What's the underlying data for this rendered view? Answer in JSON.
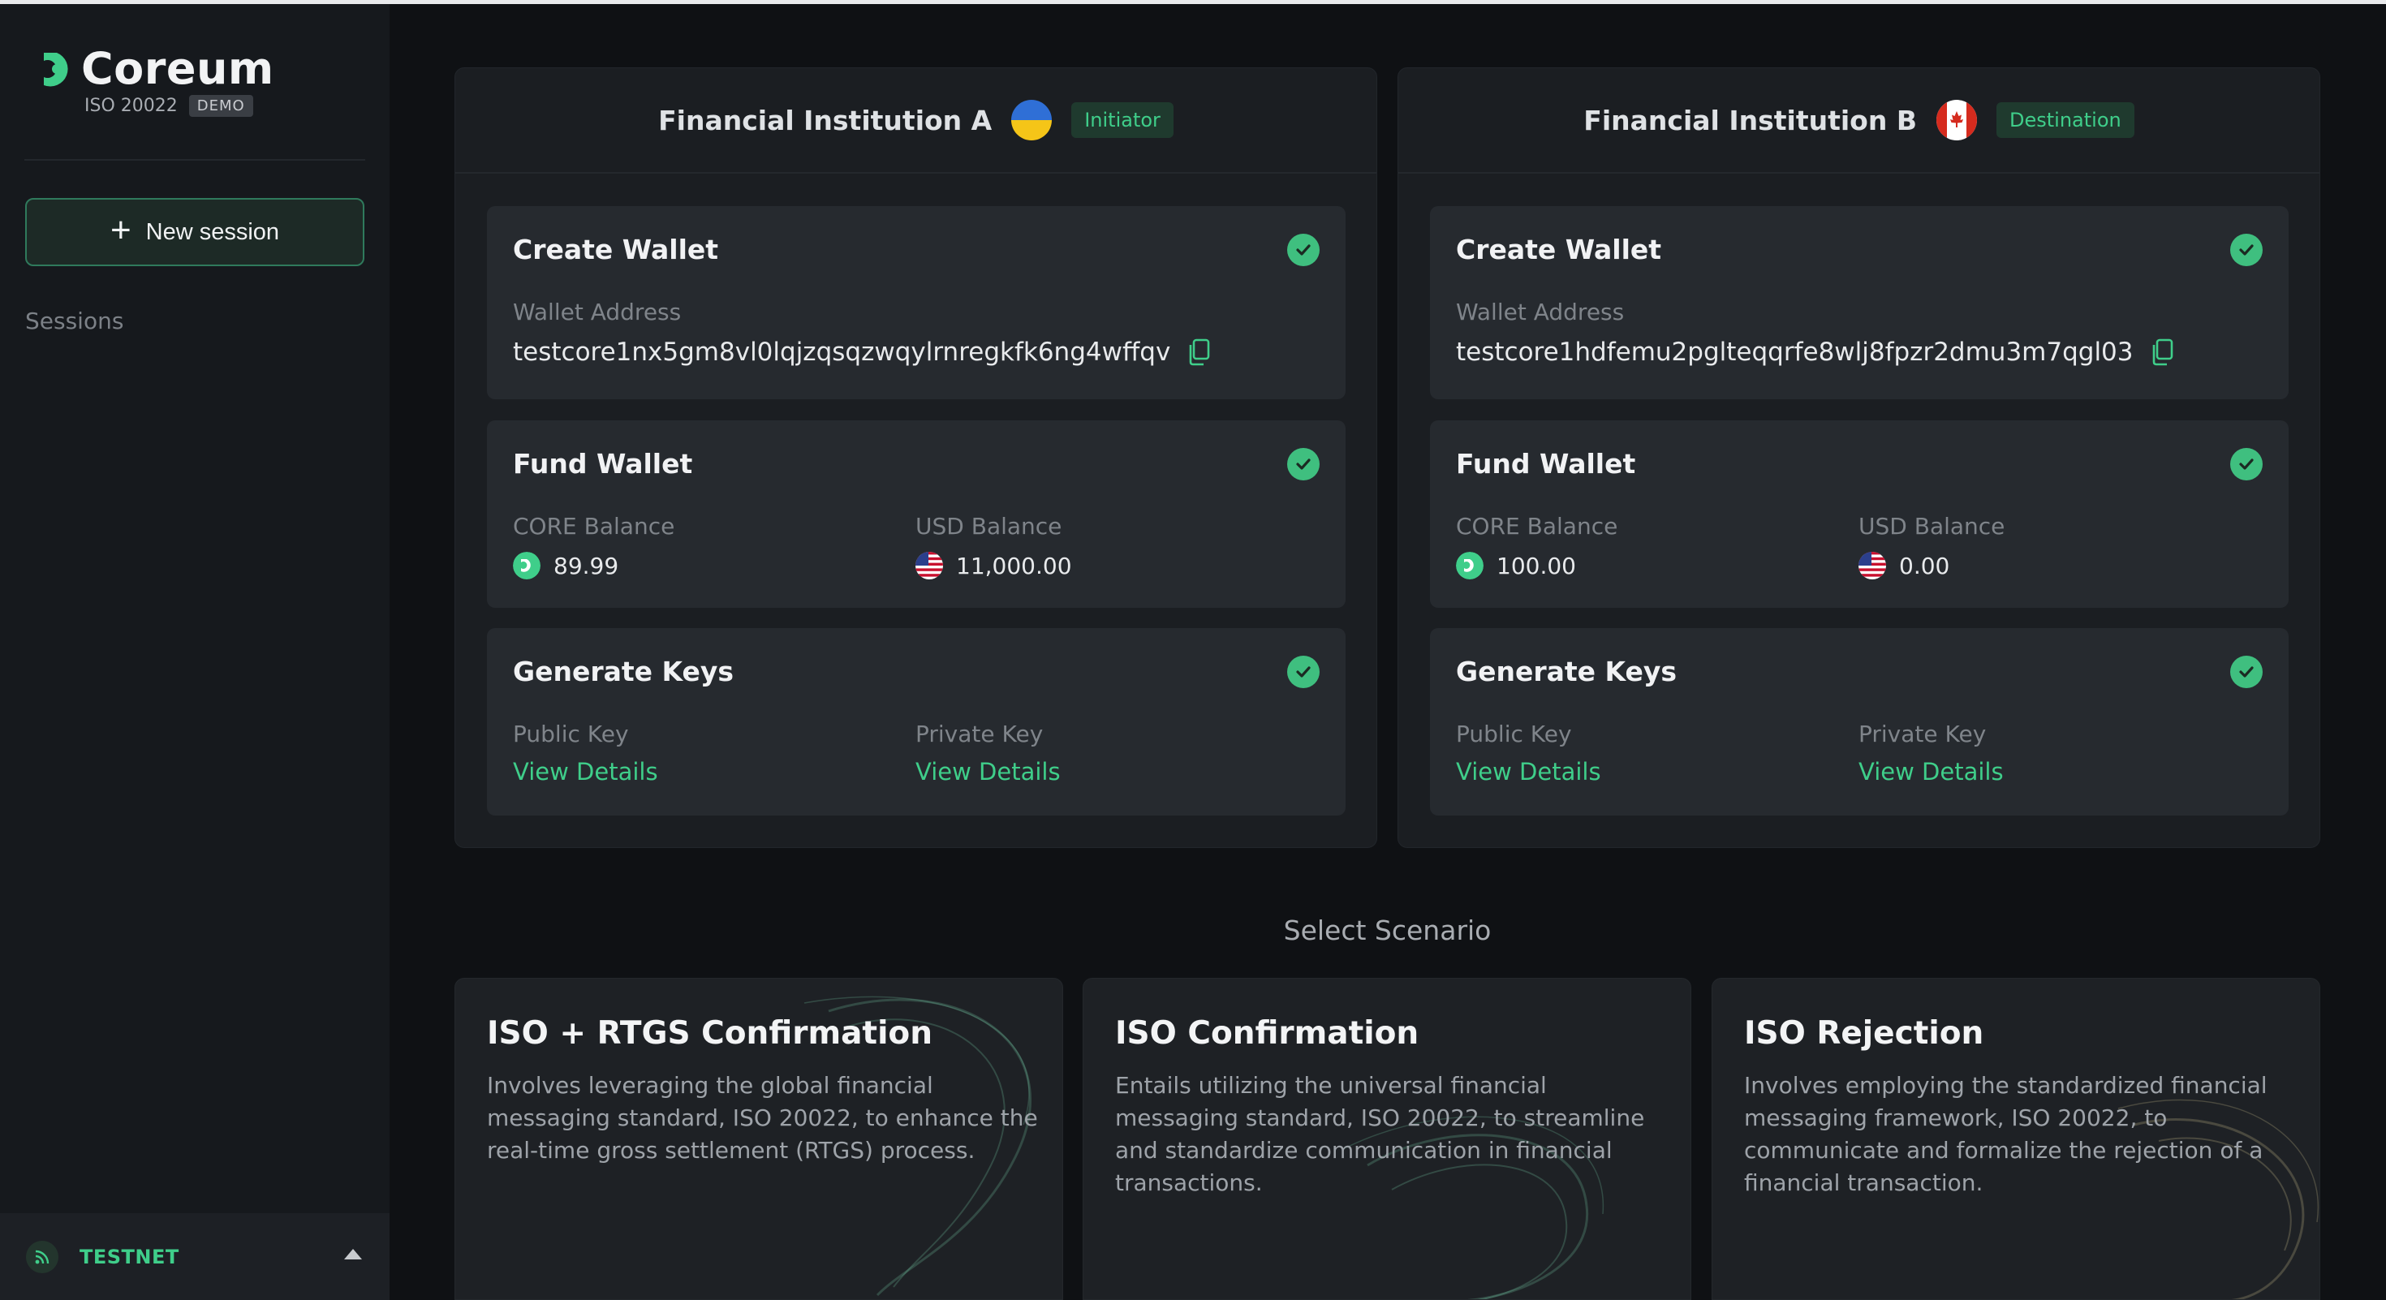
{
  "app": {
    "brand": "Coreum",
    "subtitle": "ISO 20022",
    "badge": "DEMO"
  },
  "sidebar": {
    "new_session_label": "New session",
    "sessions_label": "Sessions",
    "network_label": "TESTNET"
  },
  "institutions": [
    {
      "name": "Financial Institution A",
      "role": "Initiator",
      "flag": "ukraine-flag",
      "create_wallet": {
        "title": "Create Wallet",
        "address_label": "Wallet Address",
        "address": "testcore1nx5gm8vl0lqjzqsqzwqylrnregkfk6ng4wffqv"
      },
      "fund_wallet": {
        "title": "Fund Wallet",
        "core_label": "CORE Balance",
        "core_value": "89.99",
        "usd_label": "USD Balance",
        "usd_value": "11,000.00"
      },
      "generate_keys": {
        "title": "Generate Keys",
        "public_label": "Public Key",
        "public_link": "View Details",
        "private_label": "Private Key",
        "private_link": "View Details"
      }
    },
    {
      "name": "Financial Institution B",
      "role": "Destination",
      "flag": "canada-flag",
      "create_wallet": {
        "title": "Create Wallet",
        "address_label": "Wallet Address",
        "address": "testcore1hdfemu2pglteqqrfe8wlj8fpzr2dmu3m7qgl03"
      },
      "fund_wallet": {
        "title": "Fund Wallet",
        "core_label": "CORE Balance",
        "core_value": "100.00",
        "usd_label": "USD Balance",
        "usd_value": "0.00"
      },
      "generate_keys": {
        "title": "Generate Keys",
        "public_label": "Public Key",
        "public_link": "View Details",
        "private_label": "Private Key",
        "private_link": "View Details"
      }
    }
  ],
  "scenario": {
    "heading": "Select Scenario",
    "cards": [
      {
        "title": "ISO + RTGS Confirmation",
        "description": "Involves leveraging the global financial messaging standard, ISO 20022, to enhance the real-time gross settlement (RTGS) process."
      },
      {
        "title": "ISO Confirmation",
        "description": "Entails utilizing the universal financial messaging standard, ISO 20022, to streamline and standardize communication in financial transactions."
      },
      {
        "title": "ISO Rejection",
        "description": "Involves employing the standardized financial messaging framework, ISO 20022, to communicate and formalize the rejection of a financial transaction."
      }
    ]
  },
  "colors": {
    "accent": "#3fce8a",
    "background": "#0f1114",
    "card": "#262a2f"
  }
}
